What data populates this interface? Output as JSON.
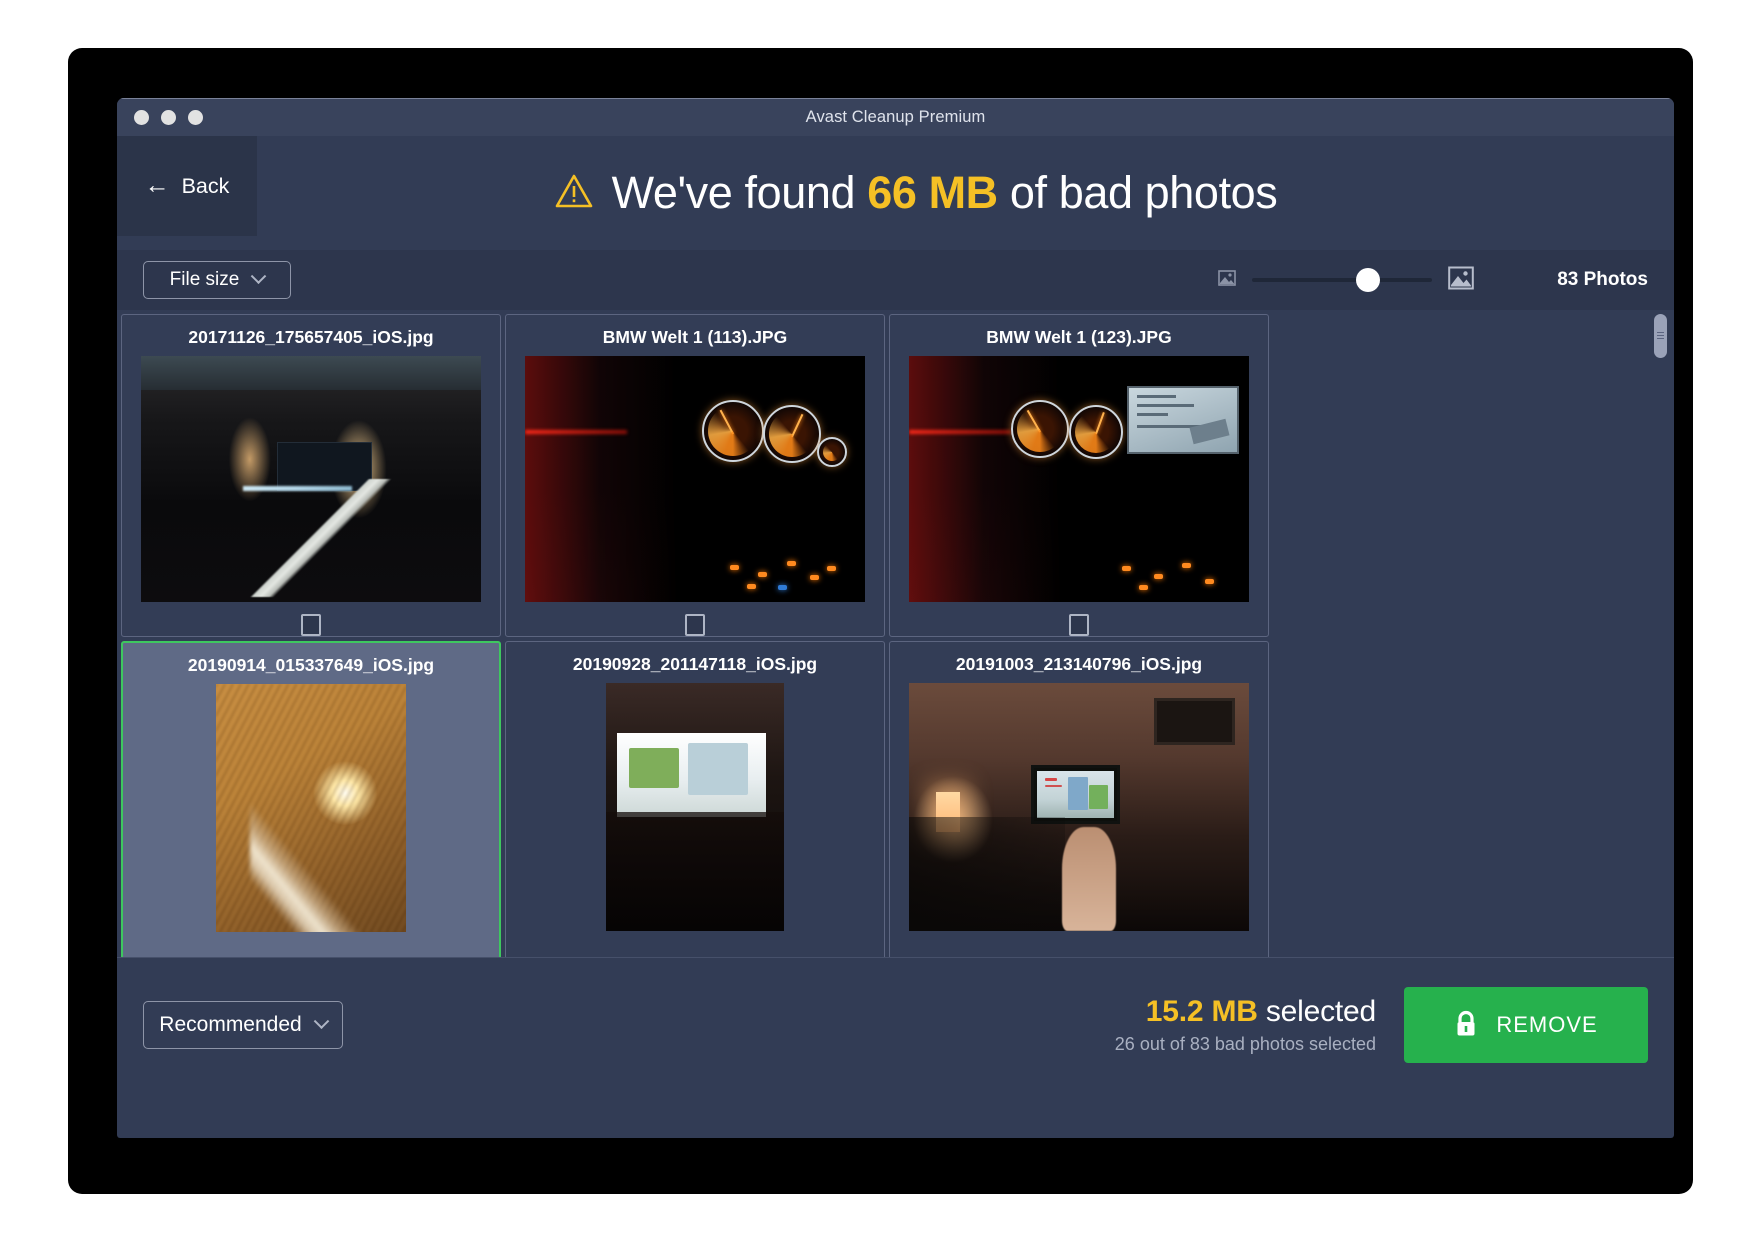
{
  "window": {
    "title": "Avast Cleanup Premium"
  },
  "header": {
    "back_label": "Back",
    "back_arrow": "←",
    "warning_icon": "warning-triangle-icon",
    "title_prefix": "We've found ",
    "title_amount": "66 MB",
    "title_suffix": " of bad photos"
  },
  "toolbar": {
    "sort_label": "File size",
    "small_image_icon": "image-small-icon",
    "large_image_icon": "image-large-icon",
    "zoom_slider_value": 58,
    "photo_count": "83 Photos"
  },
  "photos": [
    {
      "filename": "20171126_175657405_iOS.jpg",
      "selected": false,
      "checked": false,
      "art": "room1",
      "orientation": "landscape"
    },
    {
      "filename": "BMW Welt 1 (113).JPG",
      "selected": false,
      "checked": false,
      "art": "dash",
      "orientation": "landscape"
    },
    {
      "filename": "BMW Welt 1 (123).JPG",
      "selected": false,
      "checked": false,
      "art": "dash-nav",
      "orientation": "landscape"
    },
    {
      "filename": "20190914_015337649_iOS.jpg",
      "selected": true,
      "checked": false,
      "art": "sun",
      "orientation": "portrait"
    },
    {
      "filename": "20190928_201147118_iOS.jpg",
      "selected": false,
      "checked": false,
      "art": "tvdark",
      "orientation": "narrow"
    },
    {
      "filename": "20191003_213140796_iOS.jpg",
      "selected": false,
      "checked": false,
      "art": "room2",
      "orientation": "landscape"
    }
  ],
  "footer": {
    "filter_label": "Recommended",
    "selected_amount": "15.2 MB",
    "selected_word": " selected",
    "selected_subtitle": "26 out of 83 bad photos selected",
    "remove_label": "REMOVE",
    "lock_icon": "lock-icon"
  },
  "colors": {
    "accent_amber": "#f5c025",
    "accent_green": "#26b14d",
    "selection_green": "#3ec75f",
    "window_bg": "#323c55",
    "toolbar_bg": "#2d364d",
    "titlebar_bg": "#39435c"
  }
}
